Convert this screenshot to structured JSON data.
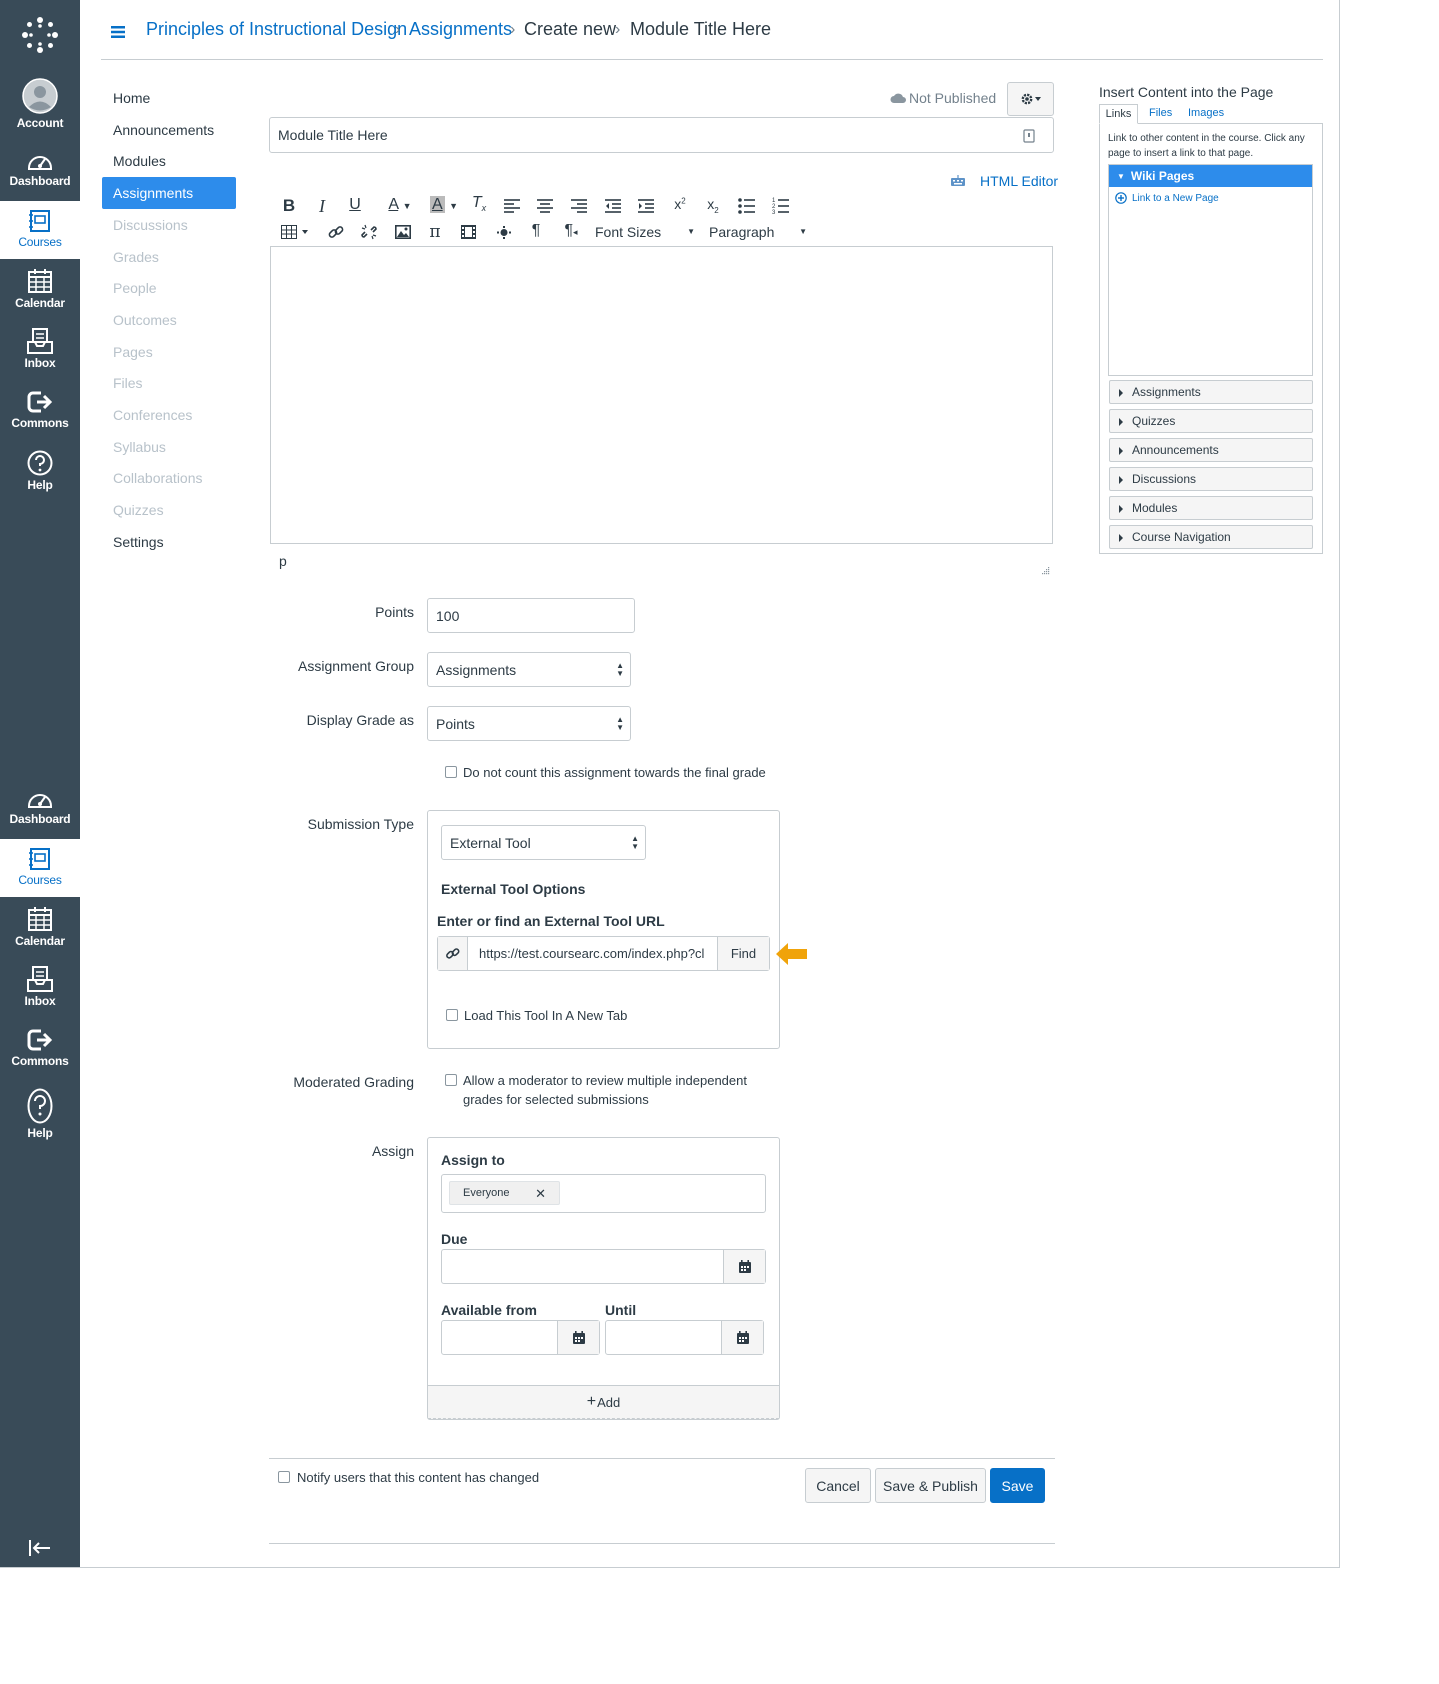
{
  "global_nav": {
    "top_items": [
      {
        "key": "account",
        "label": "Account",
        "icon": "account-icon"
      },
      {
        "key": "dashboard",
        "label": "Dashboard",
        "icon": "dashboard-icon"
      },
      {
        "key": "courses",
        "label": "Courses",
        "icon": "courses-icon"
      },
      {
        "key": "calendar",
        "label": "Calendar",
        "icon": "calendar-icon"
      },
      {
        "key": "inbox",
        "label": "Inbox",
        "icon": "inbox-icon"
      },
      {
        "key": "commons",
        "label": "Commons",
        "icon": "commons-icon"
      },
      {
        "key": "help",
        "label": "Help",
        "icon": "help-icon"
      }
    ],
    "bottom_items": [
      {
        "key": "dashboard",
        "label": "Dashboard",
        "icon": "dashboard-icon"
      },
      {
        "key": "courses",
        "label": "Courses",
        "icon": "courses-icon"
      },
      {
        "key": "calendar",
        "label": "Calendar",
        "icon": "calendar-icon"
      },
      {
        "key": "inbox",
        "label": "Inbox",
        "icon": "inbox-icon"
      },
      {
        "key": "commons",
        "label": "Commons",
        "icon": "commons-icon"
      },
      {
        "key": "help",
        "label": "Help",
        "icon": "help-icon"
      }
    ],
    "active": "courses"
  },
  "breadcrumb": {
    "course": "Principles of Instructional Design",
    "section": "Assignments",
    "action": "Create new",
    "current": "Module Title Here"
  },
  "course_nav": {
    "items": [
      "Home",
      "Announcements",
      "Modules",
      "Assignments",
      "Discussions",
      "Grades",
      "People",
      "Outcomes",
      "Pages",
      "Files",
      "Conferences",
      "Syllabus",
      "Collaborations",
      "Quizzes",
      "Settings"
    ],
    "active": "Assignments"
  },
  "editor": {
    "publish_status": "Not Published",
    "title_value": "Module Title Here",
    "html_editor_label": "HTML Editor",
    "font_sizes_label": "Font Sizes",
    "paragraph_label": "Paragraph",
    "path_label": "p"
  },
  "form": {
    "points_label": "Points",
    "points_value": "100",
    "assignment_group_label": "Assignment Group",
    "assignment_group_value": "Assignments",
    "display_grade_label": "Display Grade as",
    "display_grade_value": "Points",
    "no_count_label": "Do not count this assignment towards the final grade",
    "submission_type_label": "Submission Type",
    "submission_type_value": "External Tool",
    "external_tool_options": "External Tool Options",
    "external_tool_url_label": "Enter or find an External Tool URL",
    "external_tool_url_value": "https://test.coursearc.com/index.php?cl",
    "find_label": "Find",
    "new_tab_label": "Load This Tool In A New Tab",
    "moderated_label": "Moderated Grading",
    "moderated_text_1": "Allow a moderator to review multiple independent",
    "moderated_text_2": "grades for selected submissions",
    "assign_label": "Assign",
    "assign_to_label": "Assign to",
    "assign_to_token": "Everyone",
    "due_label": "Due",
    "available_from_label": "Available from",
    "until_label": "Until",
    "add_label": "Add"
  },
  "footer": {
    "notify_label": "Notify users that this content has changed",
    "cancel_label": "Cancel",
    "save_publish_label": "Save & Publish",
    "save_label": "Save"
  },
  "right_panel": {
    "title": "Insert Content into the Page",
    "tabs": [
      "Links",
      "Files",
      "Images"
    ],
    "help_text": "Link to other content in the course. Click any page to insert a link to that page.",
    "wiki_pages": "Wiki Pages",
    "new_page_link": "Link to a New Page",
    "sections": [
      "Assignments",
      "Quizzes",
      "Announcements",
      "Discussions",
      "Modules",
      "Course Navigation"
    ]
  },
  "colors": {
    "nav_bg": "#394b58",
    "link": "#0770c7",
    "active_bg": "#2d8ceb",
    "callout_arrow": "#f0a30a"
  }
}
